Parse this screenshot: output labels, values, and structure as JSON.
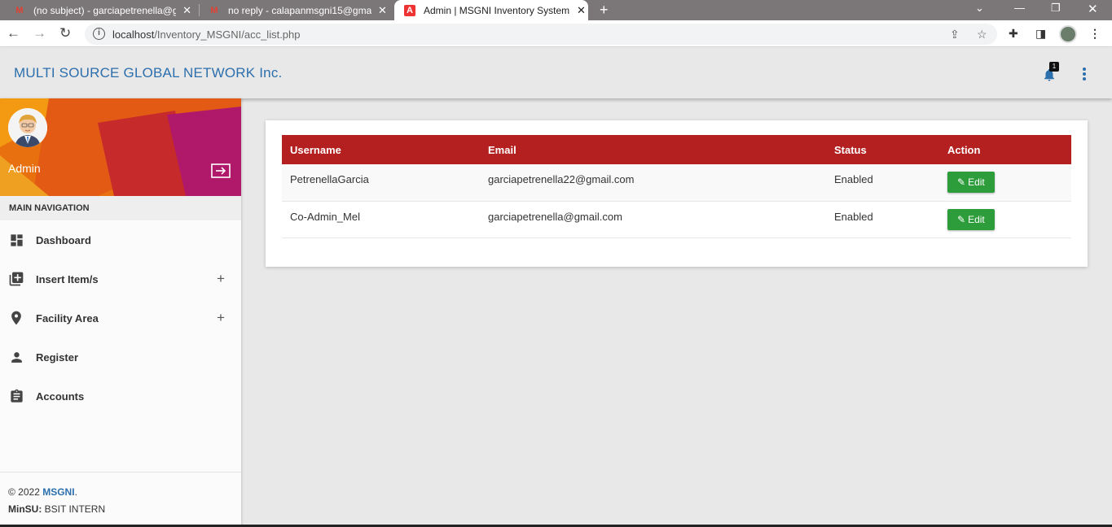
{
  "browser": {
    "tabs": [
      {
        "title": "(no subject) - garciapetrenella@g",
        "icon": "gmail-icon",
        "active": false
      },
      {
        "title": "no reply - calapanmsgni15@gma",
        "icon": "gmail-icon",
        "active": false
      },
      {
        "title": "Admin | MSGNI Inventory System",
        "icon": "pdf-icon",
        "active": true
      }
    ],
    "url_host": "localhost",
    "url_path": "/Inventory_MSGNI/acc_list.php"
  },
  "header": {
    "brand": "MULTI SOURCE GLOBAL NETWORK Inc.",
    "notification_count": "1"
  },
  "sidebar": {
    "user_name": "Admin",
    "nav_header": "MAIN NAVIGATION",
    "items": [
      {
        "label": "Dashboard",
        "icon": "dashboard-icon",
        "expandable": false
      },
      {
        "label": "Insert Item/s",
        "icon": "library-add-icon",
        "expandable": true
      },
      {
        "label": "Facility Area",
        "icon": "location-pin-icon",
        "expandable": true
      },
      {
        "label": "Register",
        "icon": "person-icon",
        "expandable": false
      },
      {
        "label": "Accounts",
        "icon": "assignment-icon",
        "expandable": false
      }
    ],
    "expand_symbol": "+",
    "footer": {
      "copyright": "© 2022 ",
      "brand_link": "MSGNI",
      "period": ".",
      "school_label": "MinSU:",
      "school_text": " BSIT INTERN"
    }
  },
  "accounts_table": {
    "columns": [
      "Username",
      "Email",
      "Status",
      "Action"
    ],
    "rows": [
      {
        "username": "PetrenellaGarcia",
        "email": "garciapetrenella22@gmail.com",
        "status": "Enabled",
        "action": "Edit"
      },
      {
        "username": "Co-Admin_Mel",
        "email": "garciapetrenella@gmail.com",
        "status": "Enabled",
        "action": "Edit"
      }
    ]
  },
  "colors": {
    "brand": "#2c6fad",
    "table_header": "#b42020",
    "edit_button": "#2d9c3a"
  }
}
